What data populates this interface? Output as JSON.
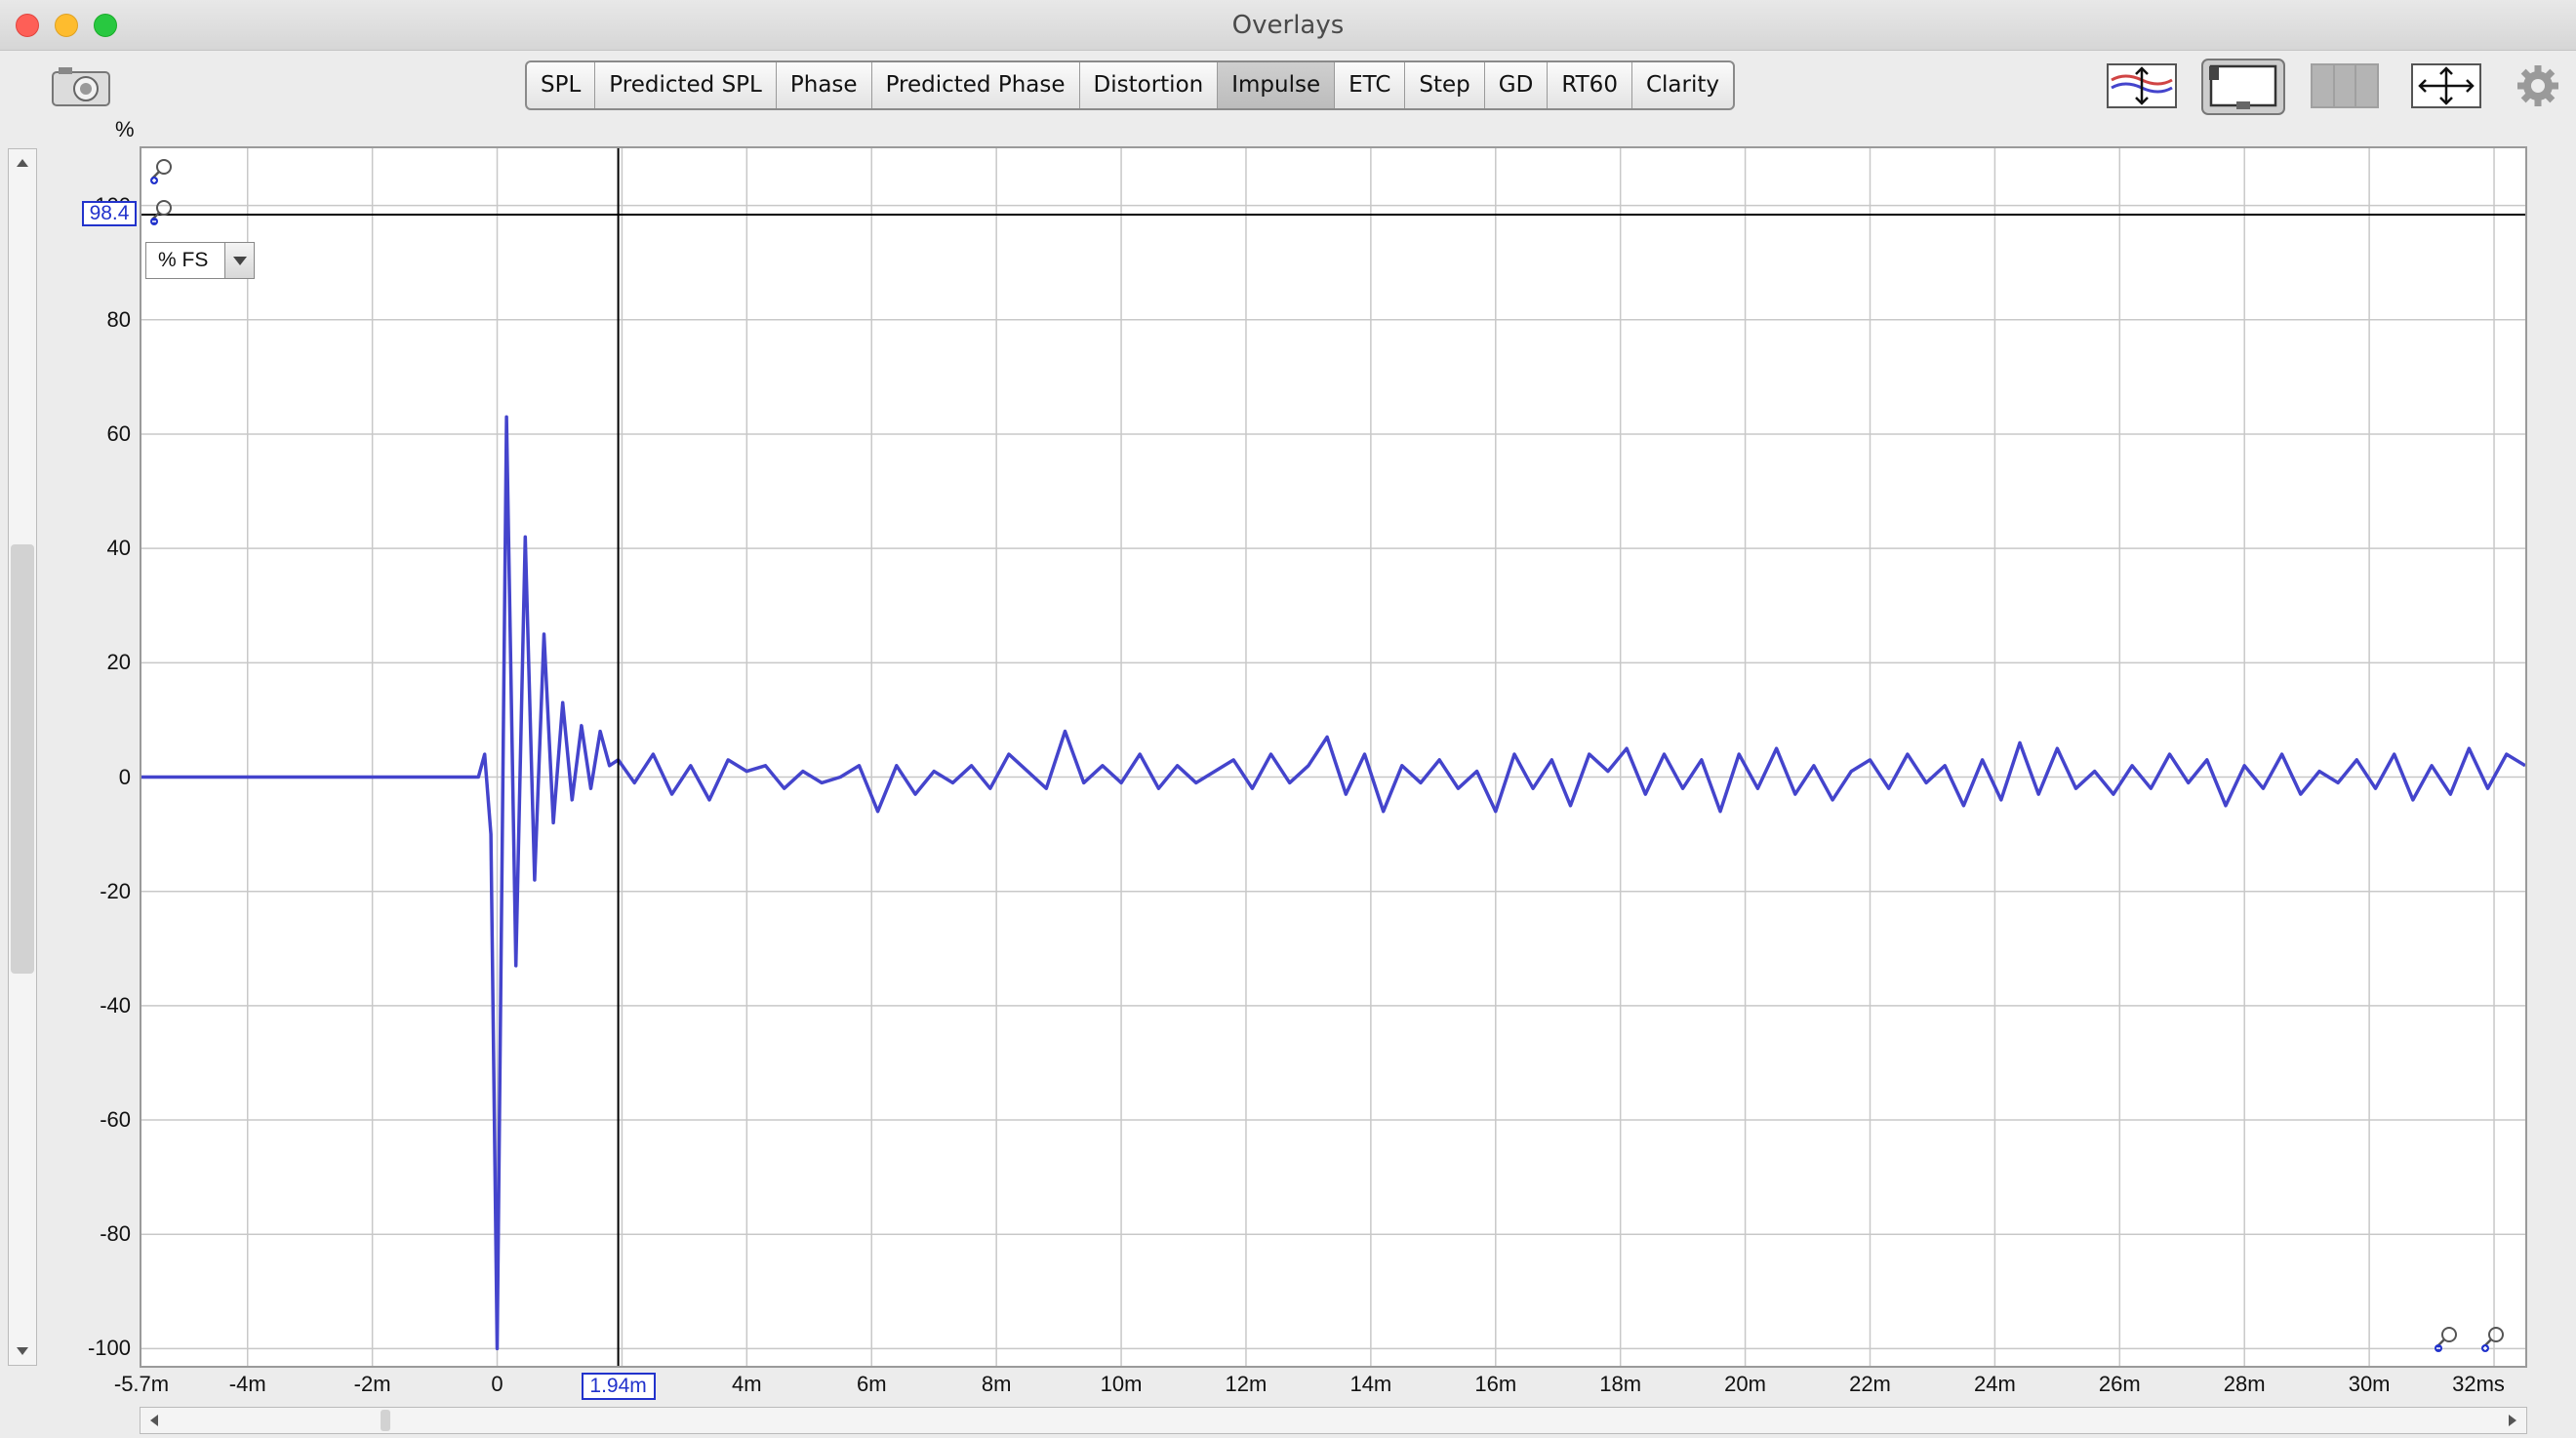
{
  "window": {
    "title": "Overlays"
  },
  "toolbar": {
    "tabs": [
      "SPL",
      "Predicted SPL",
      "Phase",
      "Predicted Phase",
      "Distortion",
      "Impulse",
      "ETC",
      "Step",
      "GD",
      "RT60",
      "Clarity"
    ],
    "active_tab": "Impulse",
    "icons": [
      "camera-icon",
      "vertical-fit-icon",
      "display-mode-icon",
      "grid-panel-icon",
      "expand-arrows-icon",
      "gear-icon"
    ]
  },
  "plot": {
    "y_unit": "%",
    "y_cursor_readout": "98.4",
    "x_cursor_readout": "1.94m",
    "units_select_value": "% FS",
    "colors": {
      "trace": "#4444cc",
      "grid": "#c8c8c8",
      "cursor": "#000000",
      "readout_border": "#2233cc"
    }
  },
  "chart_data": {
    "type": "line",
    "title": "",
    "xlabel": "",
    "ylabel": "%",
    "xlim": [
      -5.7,
      32.5
    ],
    "ylim": [
      -103,
      110
    ],
    "x_ticks": [
      "-5.7m",
      "-4m",
      "-2m",
      "0",
      "2m",
      "4m",
      "6m",
      "8m",
      "10m",
      "12m",
      "14m",
      "16m",
      "18m",
      "20m",
      "22m",
      "24m",
      "26m",
      "28m",
      "30m",
      "32ms"
    ],
    "y_ticks": [
      "100",
      "80",
      "60",
      "40",
      "20",
      "0",
      "-20",
      "-40",
      "-60",
      "-80",
      "-100"
    ],
    "cursor": {
      "x": 1.94,
      "y": 98.4
    },
    "series": [
      {
        "name": "",
        "x": [
          -5.7,
          -0.3,
          -0.2,
          -0.1,
          0.0,
          0.15,
          0.3,
          0.45,
          0.6,
          0.75,
          0.9,
          1.05,
          1.2,
          1.35,
          1.5,
          1.65,
          1.8,
          1.94,
          2.2,
          2.5,
          2.8,
          3.1,
          3.4,
          3.7,
          4.0,
          4.3,
          4.6,
          4.9,
          5.2,
          5.5,
          5.8,
          6.1,
          6.4,
          6.7,
          7.0,
          7.3,
          7.6,
          7.9,
          8.2,
          8.5,
          8.8,
          9.1,
          9.4,
          9.7,
          10.0,
          10.3,
          10.6,
          10.9,
          11.2,
          11.5,
          11.8,
          12.1,
          12.4,
          12.7,
          13.0,
          13.3,
          13.6,
          13.9,
          14.2,
          14.5,
          14.8,
          15.1,
          15.4,
          15.7,
          16.0,
          16.3,
          16.6,
          16.9,
          17.2,
          17.5,
          17.8,
          18.1,
          18.4,
          18.7,
          19.0,
          19.3,
          19.6,
          19.9,
          20.2,
          20.5,
          20.8,
          21.1,
          21.4,
          21.7,
          22.0,
          22.3,
          22.6,
          22.9,
          23.2,
          23.5,
          23.8,
          24.1,
          24.4,
          24.7,
          25.0,
          25.3,
          25.6,
          25.9,
          26.2,
          26.5,
          26.8,
          27.1,
          27.4,
          27.7,
          28.0,
          28.3,
          28.6,
          28.9,
          29.2,
          29.5,
          29.8,
          30.1,
          30.4,
          30.7,
          31.0,
          31.3,
          31.6,
          31.9,
          32.2,
          32.5
        ],
        "y": [
          0,
          0,
          4,
          -10,
          -100,
          63,
          -33,
          42,
          -18,
          25,
          -8,
          13,
          -4,
          9,
          -2,
          8,
          2,
          3,
          -1,
          4,
          -3,
          2,
          -4,
          3,
          1,
          2,
          -2,
          1,
          -1,
          0,
          2,
          -6,
          2,
          -3,
          1,
          -1,
          2,
          -2,
          4,
          1,
          -2,
          8,
          -1,
          2,
          -1,
          4,
          -2,
          2,
          -1,
          1,
          3,
          -2,
          4,
          -1,
          2,
          7,
          -3,
          4,
          -6,
          2,
          -1,
          3,
          -2,
          1,
          -6,
          4,
          -2,
          3,
          -5,
          4,
          1,
          5,
          -3,
          4,
          -2,
          3,
          -6,
          4,
          -2,
          5,
          -3,
          2,
          -4,
          1,
          3,
          -2,
          4,
          -1,
          2,
          -5,
          3,
          -4,
          6,
          -3,
          5,
          -2,
          1,
          -3,
          2,
          -2,
          4,
          -1,
          3,
          -5,
          2,
          -2,
          4,
          -3,
          1,
          -1,
          3,
          -2,
          4,
          -4,
          2,
          -3,
          5,
          -2,
          4,
          2
        ]
      }
    ],
    "grid": true,
    "legend": "none"
  }
}
